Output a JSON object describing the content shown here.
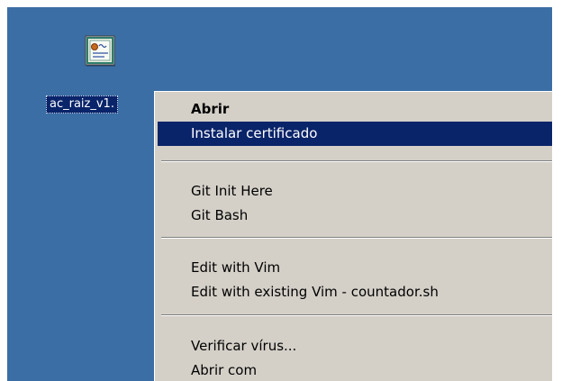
{
  "desktop": {
    "background_color": "#3a6ea5",
    "file": {
      "icon": "certificate-icon",
      "label": "ac_raiz_v1."
    }
  },
  "context_menu": {
    "highlight_color": "#0a246a",
    "items": [
      {
        "label": "Abrir",
        "bold": true
      },
      {
        "label": "Instalar certificado",
        "selected": true
      },
      {
        "label": "Git Init Here"
      },
      {
        "label": "Git Bash"
      },
      {
        "label": "Edit with Vim"
      },
      {
        "label": "Edit with existing Vim - countador.sh"
      },
      {
        "label": "Verificar vírus..."
      },
      {
        "label": "Abrir com"
      }
    ]
  }
}
